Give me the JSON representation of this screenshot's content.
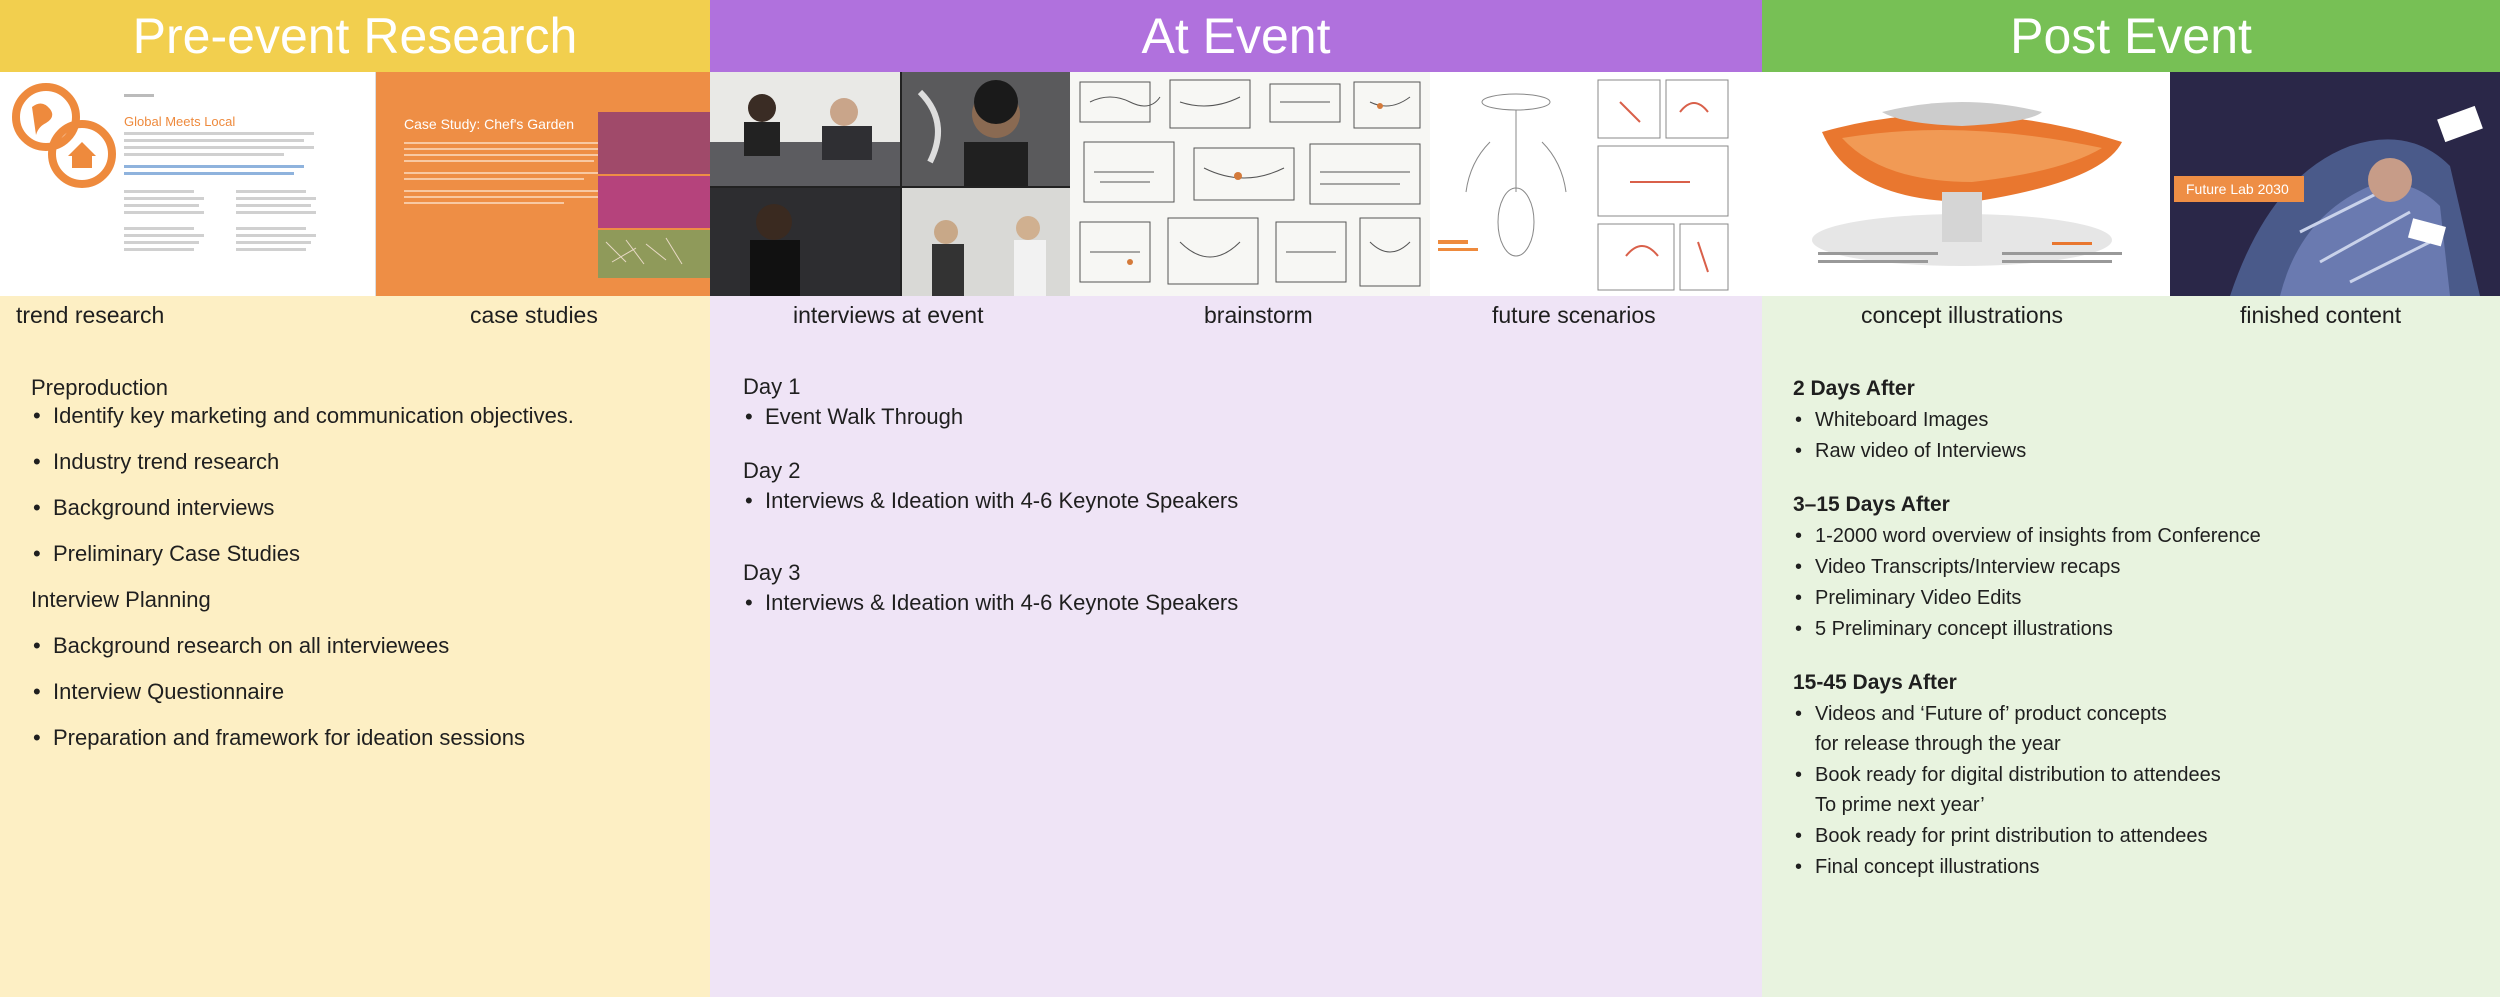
{
  "columns": {
    "pre": {
      "title": "Pre-event Research",
      "color": "#f2cf4e",
      "captions": [
        "trend research",
        "case studies"
      ],
      "thumbs": {
        "trend_title": "Global Meets Local",
        "case_title": "Case Study: Chef's Garden"
      },
      "groups": [
        {
          "title": "Preproduction",
          "items": [
            "Identify key marketing and communication objectives.",
            "Industry trend research",
            "Background interviews",
            "Preliminary Case Studies"
          ]
        },
        {
          "title": "Interview Planning",
          "items": [
            "Background research on all interviewees",
            "Interview Questionnaire",
            "Preparation and framework for ideation sessions"
          ]
        }
      ]
    },
    "at": {
      "title": "At Event",
      "color": "#b071dd",
      "captions": [
        "interviews at event",
        "brainstorm",
        "future scenarios"
      ],
      "groups": [
        {
          "title": "Day 1",
          "items": [
            "Event Walk Through"
          ]
        },
        {
          "title": "Day 2",
          "items": [
            "Interviews & Ideation with 4-6 Keynote Speakers"
          ]
        },
        {
          "title": "Day 3",
          "items": [
            "Interviews & Ideation with 4-6 Keynote Speakers"
          ]
        }
      ]
    },
    "post": {
      "title": "Post Event",
      "color": "#77c055",
      "captions": [
        "concept illustrations",
        "finished content"
      ],
      "thumbs": {
        "finished_tag": "Future Lab 2030"
      },
      "groups": [
        {
          "title": "2 Days After",
          "items": [
            {
              "text": "Whiteboard Images"
            },
            {
              "text": "Raw video of Interviews"
            }
          ]
        },
        {
          "title": "3–15 Days After",
          "items": [
            {
              "text": "1-2000 word overview of insights from Conference"
            },
            {
              "text": "Video Transcripts/Interview recaps"
            },
            {
              "text": "Preliminary Video Edits"
            },
            {
              "text": "5 Preliminary concept illustrations"
            }
          ]
        },
        {
          "title": "15-45 Days After",
          "items": [
            {
              "text": "Videos and ‘Future of’ product concepts",
              "cont": "for release through the year"
            },
            {
              "text": "Book ready for digital distribution to attendees",
              "cont": "To prime next year’"
            },
            {
              "text": "Book ready for print distribution to attendees"
            },
            {
              "text": "Final concept illustrations"
            }
          ]
        }
      ]
    }
  }
}
